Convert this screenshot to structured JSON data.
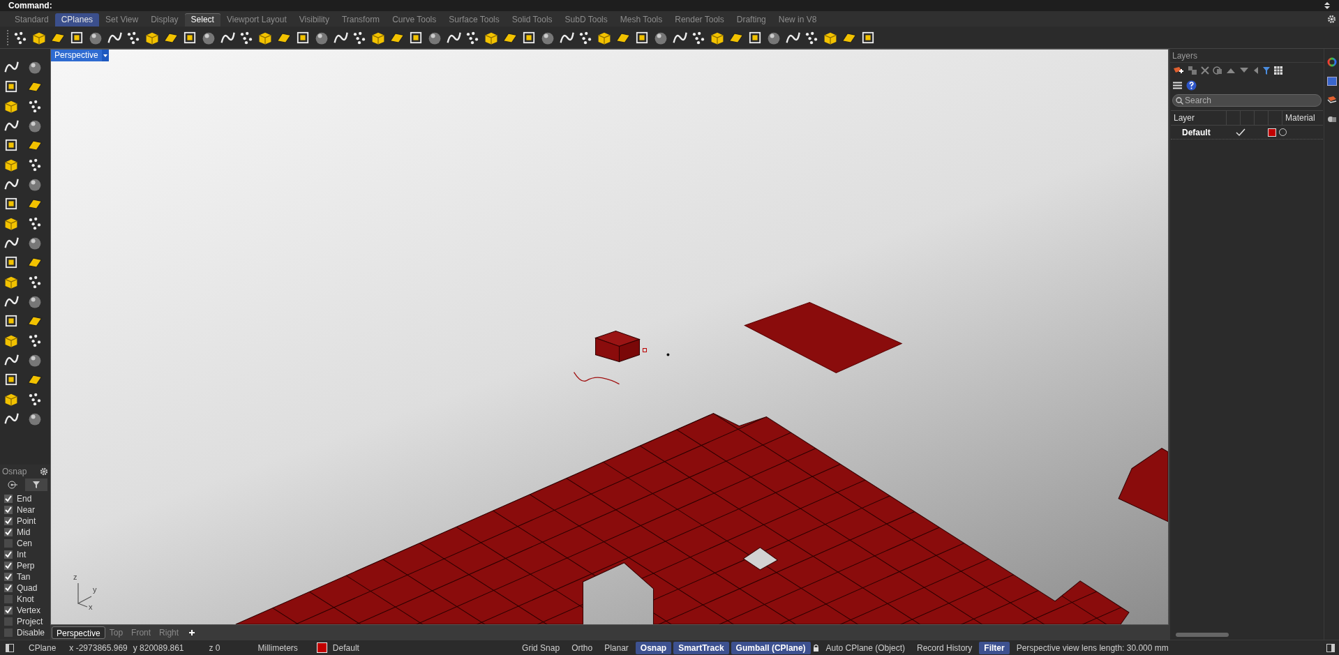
{
  "command_bar": {
    "label": "Command:"
  },
  "tabs": [
    {
      "label": "Standard",
      "selected": false,
      "highlighted": false
    },
    {
      "label": "CPlanes",
      "selected": false,
      "highlighted": true
    },
    {
      "label": "Set View",
      "selected": false,
      "highlighted": false
    },
    {
      "label": "Display",
      "selected": false,
      "highlighted": false
    },
    {
      "label": "Select",
      "selected": true,
      "highlighted": false
    },
    {
      "label": "Viewport Layout",
      "selected": false,
      "highlighted": false
    },
    {
      "label": "Visibility",
      "selected": false,
      "highlighted": false
    },
    {
      "label": "Transform",
      "selected": false,
      "highlighted": false
    },
    {
      "label": "Curve Tools",
      "selected": false,
      "highlighted": false
    },
    {
      "label": "Surface Tools",
      "selected": false,
      "highlighted": false
    },
    {
      "label": "Solid Tools",
      "selected": false,
      "highlighted": false
    },
    {
      "label": "SubD Tools",
      "selected": false,
      "highlighted": false
    },
    {
      "label": "Mesh Tools",
      "selected": false,
      "highlighted": false
    },
    {
      "label": "Render Tools",
      "selected": false,
      "highlighted": false
    },
    {
      "label": "Drafting",
      "selected": false,
      "highlighted": false
    },
    {
      "label": "New in V8",
      "selected": false,
      "highlighted": false
    }
  ],
  "viewport": {
    "title": "Perspective",
    "axis_labels": [
      "z",
      "y",
      "x"
    ]
  },
  "osnap": {
    "title": "Osnap",
    "items": [
      {
        "label": "End",
        "checked": true
      },
      {
        "label": "Near",
        "checked": true
      },
      {
        "label": "Point",
        "checked": true
      },
      {
        "label": "Mid",
        "checked": true
      },
      {
        "label": "Cen",
        "checked": false
      },
      {
        "label": "Int",
        "checked": true
      },
      {
        "label": "Perp",
        "checked": true
      },
      {
        "label": "Tan",
        "checked": true
      },
      {
        "label": "Quad",
        "checked": true
      },
      {
        "label": "Knot",
        "checked": false
      },
      {
        "label": "Vertex",
        "checked": true
      },
      {
        "label": "Project",
        "checked": false
      },
      {
        "label": "Disable",
        "checked": false
      }
    ]
  },
  "layers_panel": {
    "title": "Layers",
    "search": {
      "placeholder": "Search"
    },
    "columns": [
      "Layer",
      "Material"
    ],
    "rows": [
      {
        "name": "Default",
        "current": true,
        "color": "#c00000"
      }
    ]
  },
  "viewport_tabs": [
    {
      "label": "Perspective",
      "selected": true
    },
    {
      "label": "Top",
      "selected": false
    },
    {
      "label": "Front",
      "selected": false
    },
    {
      "label": "Right",
      "selected": false
    }
  ],
  "status_bar": {
    "cplane": "CPlane",
    "x": "x -2973865.969",
    "y": "y 820089.861",
    "z": "z 0",
    "units": "Millimeters",
    "layer": {
      "name": "Default",
      "color": "#c00000"
    },
    "toggles": [
      {
        "label": "Grid Snap",
        "on": false,
        "kind": "toggle"
      },
      {
        "label": "Ortho",
        "on": false,
        "kind": "toggle"
      },
      {
        "label": "Planar",
        "on": false,
        "kind": "toggle"
      },
      {
        "label": "Osnap",
        "on": true,
        "kind": "toggle"
      },
      {
        "label": "SmartTrack",
        "on": true,
        "kind": "toggle"
      },
      {
        "label": "Gumball (CPlane)",
        "on": true,
        "kind": "toggle"
      },
      {
        "label": "Auto CPlane (Object)",
        "on": false,
        "kind": "lock"
      },
      {
        "label": "Record History",
        "on": false,
        "kind": "toggle"
      },
      {
        "label": "Filter",
        "on": true,
        "kind": "toggle"
      }
    ],
    "message": "Perspective view lens length: 30.000 mm"
  }
}
